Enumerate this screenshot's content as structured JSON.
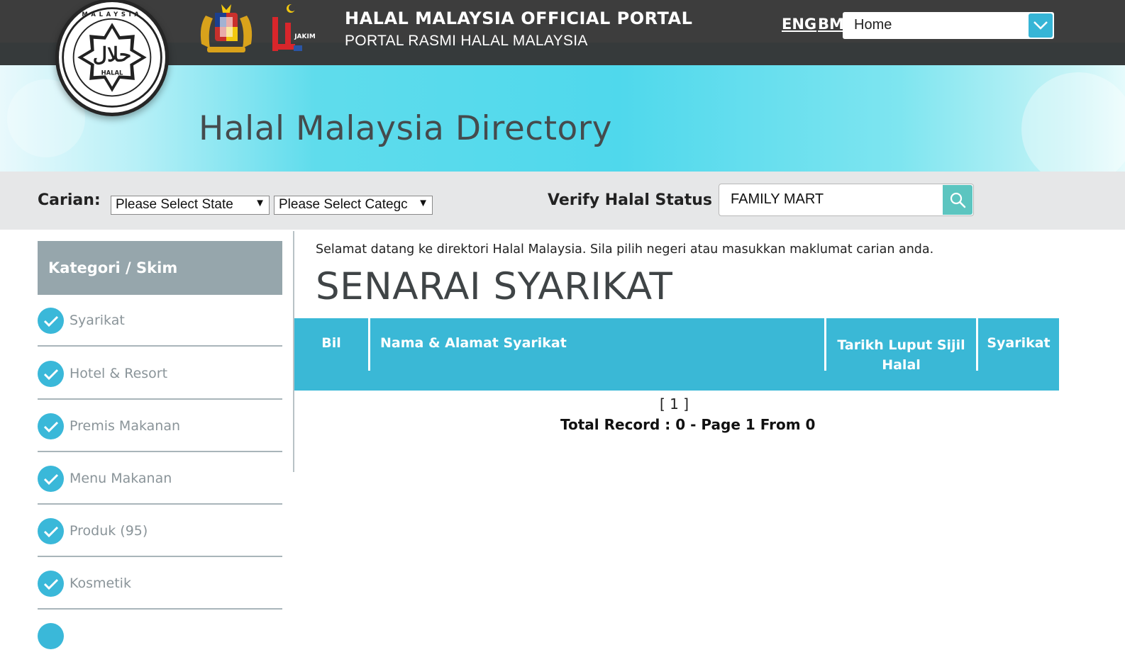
{
  "header": {
    "portal_title": "HALAL MALAYSIA OFFICIAL PORTAL",
    "portal_subtitle": "PORTAL RASMI HALAL MALAYSIA",
    "lang_eng": "ENG",
    "lang_bm": "BM",
    "nav_select_value": "Home",
    "halal_logo_text": "HALAL",
    "halal_logo_ring": "MALAYSIA",
    "jakim_text": "JAKIM"
  },
  "banner": {
    "title": "Halal Malaysia Directory"
  },
  "search": {
    "label": "Carian:",
    "state_select": "Please Select State",
    "category_select": "Please Select Categc",
    "verify_label": "Verify Halal Status :",
    "verify_value": "FAMILY MART"
  },
  "sidebar": {
    "heading": "Kategori / Skim",
    "items": [
      {
        "label": "Syarikat"
      },
      {
        "label": "Hotel & Resort"
      },
      {
        "label": "Premis Makanan"
      },
      {
        "label": "Menu Makanan"
      },
      {
        "label": "Produk (95)"
      },
      {
        "label": "Kosmetik"
      }
    ]
  },
  "main": {
    "welcome": "Selamat datang ke direktori Halal Malaysia. Sila pilih negeri atau masukkan maklumat carian anda.",
    "title": "SENARAI SYARIKAT",
    "columns": {
      "bil": "Bil",
      "nama": "Nama & Alamat Syarikat",
      "tarikh": "Tarikh Luput Sijil Halal",
      "syarikat": "Syarikat"
    },
    "pager": "[ 1 ]",
    "total": "Total Record : 0 - Page 1 From 0"
  },
  "colors": {
    "topbar": "#3d3d3d",
    "accent": "#3ab8d6",
    "sidebar_head": "#96a6ac",
    "search_btn": "#5cc5c0"
  }
}
